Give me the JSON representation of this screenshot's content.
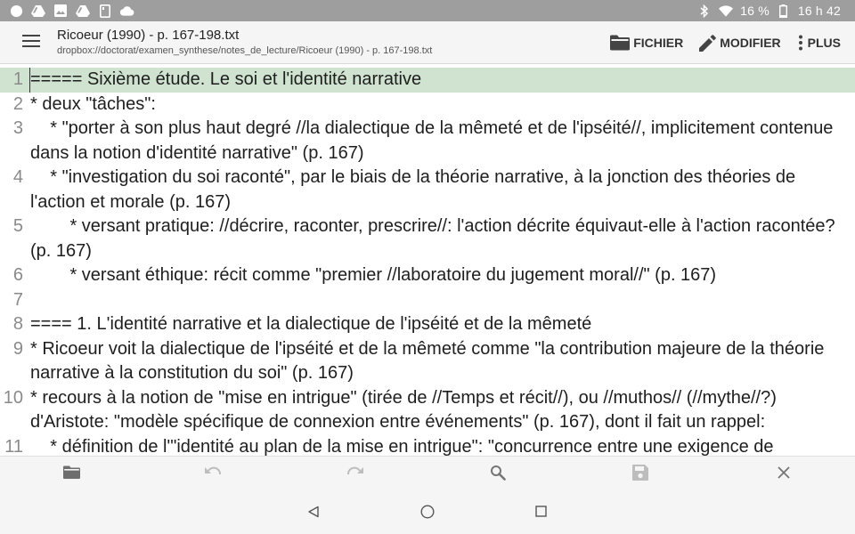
{
  "status_bar": {
    "battery": "16 %",
    "time": "16 h 42",
    "left_icons": [
      "circle-icon",
      "drive-icon",
      "image-icon",
      "drive-icon",
      "sd-card-icon",
      "cloud-icon"
    ],
    "right_icons": [
      "bluetooth-icon",
      "wifi-icon",
      "battery-icon"
    ]
  },
  "app_bar": {
    "title": "Ricoeur (1990) - p. 167-198.txt",
    "path": "dropbox://doctorat/examen_synthese/notes_de_lecture/Ricoeur (1990) - p. 167-198.txt",
    "actions": {
      "file": "FICHIER",
      "edit": "MODIFIER",
      "more": "PLUS"
    }
  },
  "editor": {
    "current_line": 1,
    "lines": [
      {
        "n": "1",
        "text": "===== Sixième étude. Le soi et l'identité narrative"
      },
      {
        "n": "2",
        "text": "* deux \"tâches\":"
      },
      {
        "n": "3",
        "text": "    * \"porter à son plus haut degré //la dialectique de la mêmeté et de l'ipséité//, implicitement contenue dans la notion d'identité narrative\" (p. 167)"
      },
      {
        "n": "4",
        "text": "    * \"investigation du soi raconté\", par le biais de la théorie narrative, à la jonction des théories de l'action et morale (p. 167)"
      },
      {
        "n": "5",
        "text": "        * versant pratique: //décrire, raconter, prescrire//: l'action décrite équivaut-elle à l'action racontée? (p. 167)"
      },
      {
        "n": "6",
        "text": "        * versant éthique: récit comme \"premier //laboratoire du jugement moral//\" (p. 167)"
      },
      {
        "n": "7",
        "text": ""
      },
      {
        "n": "8",
        "text": "==== 1. L'identité narrative et la dialectique de l'ipséité et de la mêmeté"
      },
      {
        "n": "9",
        "text": "* Ricoeur voit la dialectique de l'ipséité et de la mêmeté comme \"la contribution majeure de la théorie narrative à la constitution du soi\" (p. 167)"
      },
      {
        "n": "10",
        "text": "* recours à la notion de \"mise en intrigue\" (tirée de //Temps et récit//), ou //muthos// (//mythe//?) d'Aristote: \"modèle spécifique de connexion entre événements\" (p. 167), dont il fait un rappel:"
      },
      {
        "n": "11",
        "text": "    * définition de l'\"identité au plan de la mise en intrigue\": \"concurrence entre une exigence de"
      }
    ]
  },
  "bottom_toolbar": [
    "folder-icon",
    "undo-icon",
    "redo-icon",
    "search-icon",
    "save-icon",
    "close-icon"
  ],
  "colors": {
    "status_bar": "#9e9e9e",
    "app_bar": "#f5f5f5",
    "current_line_highlight": "#cfe3d0",
    "line_number": "#8a8a8a",
    "text": "#1e1e1e",
    "disabled_icon": "#b5b5b5",
    "active_icon": "#757575"
  }
}
